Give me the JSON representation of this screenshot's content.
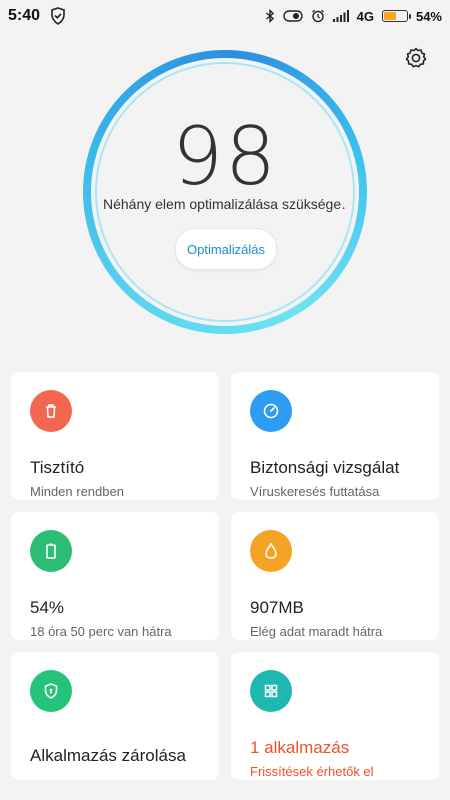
{
  "status_bar": {
    "time": "5:40",
    "network": "4G",
    "battery_percent": "54%",
    "battery_level": 0.54,
    "icons": [
      "shield-check-icon",
      "bluetooth-icon",
      "toggle-icon",
      "alarm-icon",
      "signal-icon"
    ]
  },
  "score": {
    "value": "98",
    "status": "Néhány elem optimalizálása szüksége…",
    "button_label": "Optimalizálás"
  },
  "cards": [
    {
      "id": "cleaner",
      "title": "Tisztító",
      "subtitle": "Minden rendben",
      "icon": "trash-icon",
      "color": "#f2674f"
    },
    {
      "id": "security",
      "title": "Biztonsági vizsgálat",
      "subtitle": "Víruskeresés futtatása",
      "icon": "speedometer-icon",
      "color": "#2e9cf0"
    },
    {
      "id": "battery",
      "title": "54%",
      "subtitle": "18 óra 50 perc  van hátra",
      "icon": "battery-icon",
      "color": "#2bbd74"
    },
    {
      "id": "data",
      "title": "907MB",
      "subtitle": "Elég adat maradt hátra",
      "icon": "drop-icon",
      "color": "#f4a325"
    },
    {
      "id": "applock",
      "title": "Alkalmazás zárolása",
      "subtitle": "",
      "icon": "lock-shield-icon",
      "color": "#26c27a"
    },
    {
      "id": "updates",
      "title": "1 alkalmazás",
      "subtitle": "Frissítések érhetők el",
      "icon": "apps-grid-icon",
      "color": "#1fb7b0"
    }
  ]
}
